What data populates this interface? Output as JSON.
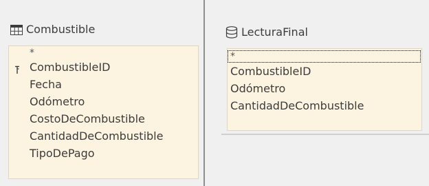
{
  "tables": [
    {
      "title": "Combustible",
      "icon": "table-grid-icon",
      "fields": [
        "*",
        "CombustibleID",
        "Fecha",
        "Odómetro",
        "CostoDeCombustible",
        "CantidadDeCombustible",
        "TipoDePago"
      ],
      "primary_key": "CombustibleID"
    },
    {
      "title": "LecturaFinal",
      "icon": "query-database-icon",
      "fields": [
        "*",
        "CombustibleID",
        "Odómetro",
        "CantidadDeCombustible"
      ],
      "selected_field": "*"
    }
  ],
  "colors": {
    "background": "#f0f0f0",
    "field_list_bg": "#fcf4e0",
    "text": "#3c3c3c",
    "divider": "#8d8d8d"
  }
}
